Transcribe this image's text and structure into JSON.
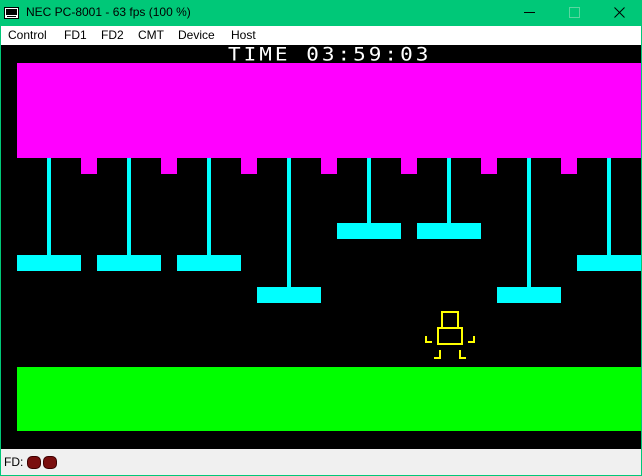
{
  "window": {
    "title": "NEC PC-8001 - 63 fps (100 %)",
    "icon": "computer-icon",
    "frame_color": "#00c878"
  },
  "menu": {
    "items": [
      {
        "label": "Control"
      },
      {
        "label": "FD1"
      },
      {
        "label": "FD2"
      },
      {
        "label": "CMT"
      },
      {
        "label": "Device"
      },
      {
        "label": "Host"
      }
    ]
  },
  "game": {
    "timer": "TIME 03:59:03",
    "colors": {
      "ceiling": "#ff00ff",
      "platform": "#00ffff",
      "floor": "#00ff00",
      "player": "#ffff00",
      "background": "#000000"
    }
  },
  "status": {
    "fd_label": "FD:",
    "drive_led_color": "#7a0e0e"
  }
}
